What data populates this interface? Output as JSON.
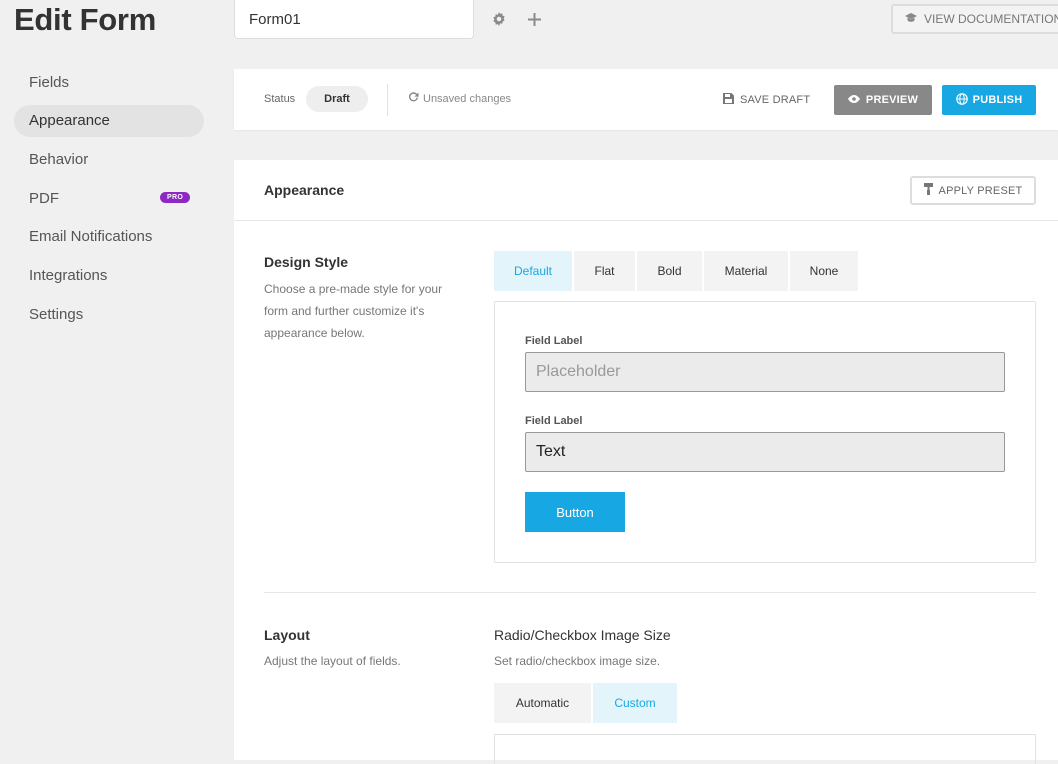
{
  "header": {
    "title": "Edit Form",
    "form_name": "Form01",
    "settings_icon": "gear-icon",
    "add_icon": "plus-icon",
    "doc_label": "VIEW DOCUMENTATION",
    "doc_icon": "graduation-cap-icon"
  },
  "sidebar": {
    "items": [
      {
        "label": "Fields"
      },
      {
        "label": "Appearance",
        "active": true
      },
      {
        "label": "Behavior"
      },
      {
        "label": "PDF",
        "badge": "PRO"
      },
      {
        "label": "Email Notifications"
      },
      {
        "label": "Integrations"
      },
      {
        "label": "Settings"
      }
    ]
  },
  "status_bar": {
    "status_label": "Status",
    "status_value": "Draft",
    "unsaved_text": "Unsaved changes",
    "save_draft_label": "SAVE DRAFT",
    "preview_label": "PREVIEW",
    "publish_label": "PUBLISH"
  },
  "appearance": {
    "title": "Appearance",
    "apply_preset_label": "APPLY PRESET",
    "design_style": {
      "title": "Design Style",
      "description": "Choose a pre-made style for your form and further customize it's appearance below.",
      "options": [
        "Default",
        "Flat",
        "Bold",
        "Material",
        "None"
      ],
      "selected": "Default"
    },
    "preview": {
      "field1_label": "Field Label",
      "field1_placeholder": "Placeholder",
      "field2_label": "Field Label",
      "field2_value": "Text",
      "button_label": "Button"
    },
    "layout": {
      "title": "Layout",
      "description": "Adjust the layout of fields.",
      "image_size_title": "Radio/Checkbox Image Size",
      "image_size_desc": "Set radio/checkbox image size.",
      "image_size_options": [
        "Automatic",
        "Custom"
      ],
      "image_size_selected": "Custom"
    }
  },
  "colors": {
    "accent": "#17a8e3",
    "pro_badge": "#8d28c5",
    "preview_button": "#888888"
  }
}
